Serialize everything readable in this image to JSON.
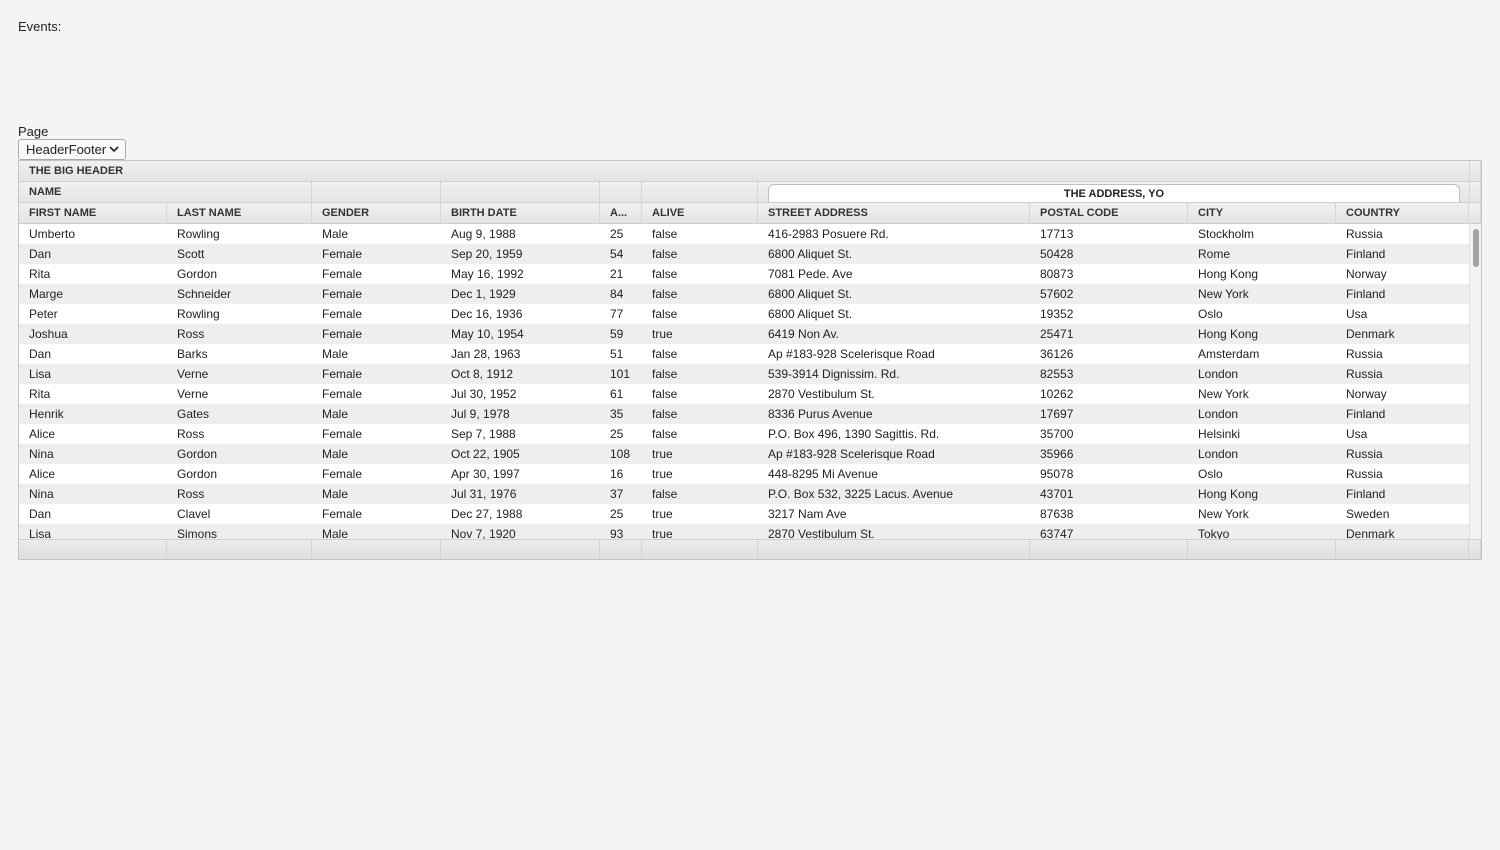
{
  "events": {
    "label": "Events:"
  },
  "page": {
    "label": "Page",
    "selected": "HeaderFooter"
  },
  "grid": {
    "big_header": "THE BIG HEADER",
    "group_headers": {
      "name": "NAME",
      "address": "THE ADDRESS, YO"
    },
    "columns": [
      "FIRST NAME",
      "LAST NAME",
      "GENDER",
      "BIRTH DATE",
      "A...",
      "ALIVE",
      "STREET ADDRESS",
      "POSTAL CODE",
      "CITY",
      "COUNTRY"
    ],
    "rows": [
      [
        "Umberto",
        "Rowling",
        "Male",
        "Aug 9, 1988",
        "25",
        "false",
        "416-2983 Posuere Rd.",
        "17713",
        "Stockholm",
        "Russia"
      ],
      [
        "Dan",
        "Scott",
        "Female",
        "Sep 20, 1959",
        "54",
        "false",
        "6800 Aliquet St.",
        "50428",
        "Rome",
        "Finland"
      ],
      [
        "Rita",
        "Gordon",
        "Female",
        "May 16, 1992",
        "21",
        "false",
        "7081 Pede. Ave",
        "80873",
        "Hong Kong",
        "Norway"
      ],
      [
        "Marge",
        "Schneider",
        "Female",
        "Dec 1, 1929",
        "84",
        "false",
        "6800 Aliquet St.",
        "57602",
        "New York",
        "Finland"
      ],
      [
        "Peter",
        "Rowling",
        "Female",
        "Dec 16, 1936",
        "77",
        "false",
        "6800 Aliquet St.",
        "19352",
        "Oslo",
        "Usa"
      ],
      [
        "Joshua",
        "Ross",
        "Female",
        "May 10, 1954",
        "59",
        "true",
        "6419 Non Av.",
        "25471",
        "Hong Kong",
        "Denmark"
      ],
      [
        "Dan",
        "Barks",
        "Male",
        "Jan 28, 1963",
        "51",
        "false",
        "Ap #183-928 Scelerisque Road",
        "36126",
        "Amsterdam",
        "Russia"
      ],
      [
        "Lisa",
        "Verne",
        "Female",
        "Oct 8, 1912",
        "101",
        "false",
        "539-3914 Dignissim. Rd.",
        "82553",
        "London",
        "Russia"
      ],
      [
        "Rita",
        "Verne",
        "Female",
        "Jul 30, 1952",
        "61",
        "false",
        "2870 Vestibulum St.",
        "10262",
        "New York",
        "Norway"
      ],
      [
        "Henrik",
        "Gates",
        "Male",
        "Jul 9, 1978",
        "35",
        "false",
        "8336 Purus Avenue",
        "17697",
        "London",
        "Finland"
      ],
      [
        "Alice",
        "Ross",
        "Female",
        "Sep 7, 1988",
        "25",
        "false",
        "P.O. Box 496, 1390 Sagittis. Rd.",
        "35700",
        "Helsinki",
        "Usa"
      ],
      [
        "Nina",
        "Gordon",
        "Male",
        "Oct 22, 1905",
        "108",
        "true",
        "Ap #183-928 Scelerisque Road",
        "35966",
        "London",
        "Russia"
      ],
      [
        "Alice",
        "Gordon",
        "Female",
        "Apr 30, 1997",
        "16",
        "true",
        "448-8295 Mi Avenue",
        "95078",
        "Oslo",
        "Russia"
      ],
      [
        "Nina",
        "Ross",
        "Male",
        "Jul 31, 1976",
        "37",
        "false",
        "P.O. Box 532, 3225 Lacus. Avenue",
        "43701",
        "Hong Kong",
        "Finland"
      ],
      [
        "Dan",
        "Clavel",
        "Female",
        "Dec 27, 1988",
        "25",
        "true",
        "3217 Nam Ave",
        "87638",
        "New York",
        "Sweden"
      ],
      [
        "Lisa",
        "Simons",
        "Male",
        "Nov 7, 1920",
        "93",
        "true",
        "2870 Vestibulum St.",
        "63747",
        "Tokyo",
        "Denmark"
      ]
    ]
  },
  "icons": {
    "dropdown": "chevron-down-icon"
  }
}
